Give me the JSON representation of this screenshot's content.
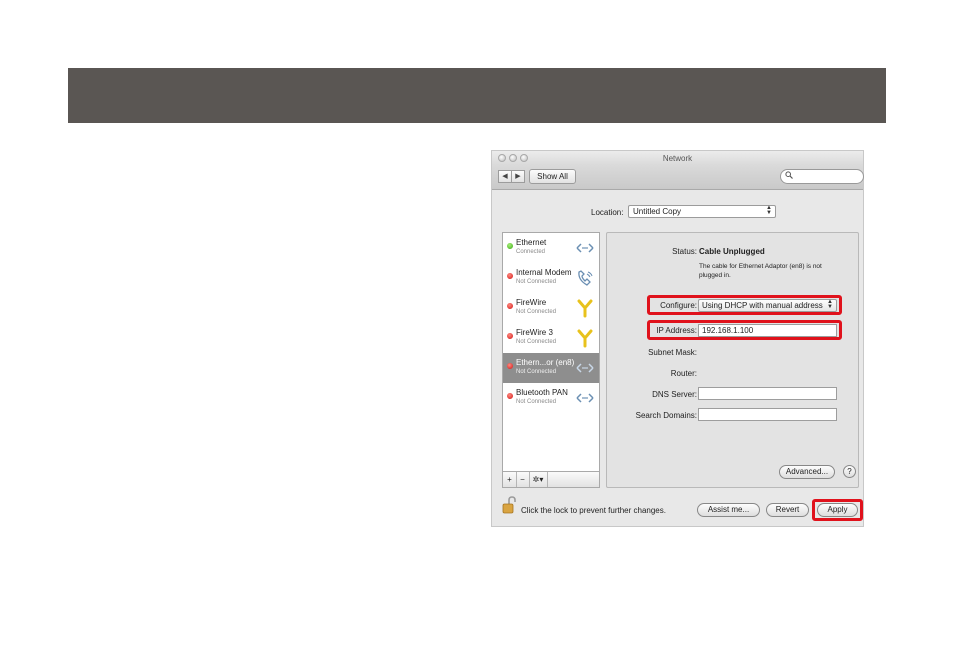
{
  "window": {
    "title": "Network",
    "show_all_label": "Show All",
    "back_glyph": "◀",
    "forward_glyph": "▶"
  },
  "location": {
    "label": "Location:",
    "value": "Untitled Copy"
  },
  "services": [
    {
      "name": "Ethernet",
      "status": "Connected",
      "state": "green",
      "icon": "ethernet-icon",
      "glyph": "<··>"
    },
    {
      "name": "Internal Modem",
      "status": "Not Connected",
      "state": "red",
      "icon": "phone-icon",
      "glyph": "☎"
    },
    {
      "name": "FireWire",
      "status": "Not Connected",
      "state": "red",
      "icon": "firewire-icon",
      "glyph": "Y"
    },
    {
      "name": "FireWire 3",
      "status": "Not Connected",
      "state": "red",
      "icon": "firewire-icon",
      "glyph": "Y"
    },
    {
      "name": "Ethern...or (en8)",
      "status": "Not Connected",
      "state": "red",
      "icon": "ethernet-icon",
      "glyph": "<··>"
    },
    {
      "name": "Bluetooth PAN",
      "status": "Not Connected",
      "state": "red",
      "icon": "ethernet-icon",
      "glyph": "<··>"
    }
  ],
  "list_controls": {
    "add": "+",
    "remove": "−",
    "action": "✲▾"
  },
  "detail": {
    "status_label": "Status:",
    "status_value": "Cable Unplugged",
    "status_desc_line1": "The cable for Ethernet Adaptor (en8) is not",
    "status_desc_line2": "plugged in.",
    "configure_label": "Configure:",
    "configure_value": "Using DHCP with manual address",
    "ip_label": "IP Address:",
    "ip_value": "192.168.1.100",
    "subnet_label": "Subnet Mask:",
    "router_label": "Router:",
    "dns_label": "DNS Server:",
    "dns_value": "",
    "search_domains_label": "Search Domains:",
    "search_domains_value": "",
    "advanced_label": "Advanced...",
    "help_label": "?"
  },
  "footer": {
    "lock_text": "Click the lock to prevent further changes.",
    "assist_label": "Assist me...",
    "revert_label": "Revert",
    "apply_label": "Apply"
  },
  "colors": {
    "header_bar": "#5a5653",
    "highlight": "#e0121c",
    "selected_row": "#8e8e8e"
  }
}
